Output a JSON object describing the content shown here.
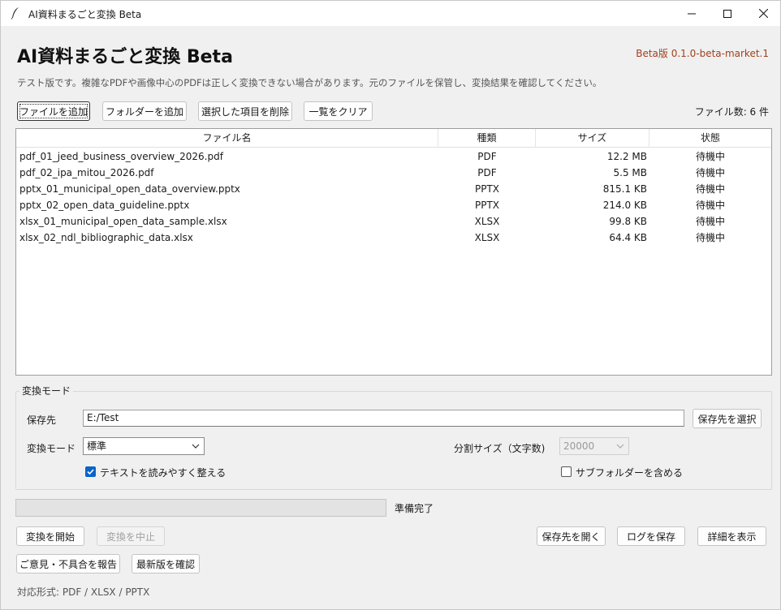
{
  "window": {
    "title": "AI資料まるごと変換 Beta"
  },
  "header": {
    "app_title": "AI資料まるごと変換 Beta",
    "version": "Beta版  0.1.0-beta-market.1",
    "notice": "テスト版です。複雑なPDFや画像中心のPDFは正しく変換できない場合があります。元のファイルを保管し、変換結果を確認してください。"
  },
  "toolbar": {
    "add_files": "ファイルを追加",
    "add_folder": "フォルダーを追加",
    "remove_selected": "選択した項目を削除",
    "clear_list": "一覧をクリア",
    "file_count": "ファイル数: 6 件"
  },
  "table": {
    "columns": [
      "ファイル名",
      "種類",
      "サイズ",
      "状態"
    ],
    "rows": [
      {
        "name": "pdf_01_jeed_business_overview_2026.pdf",
        "type": "PDF",
        "size": "12.2 MB",
        "status": "待機中"
      },
      {
        "name": "pdf_02_ipa_mitou_2026.pdf",
        "type": "PDF",
        "size": "5.5 MB",
        "status": "待機中"
      },
      {
        "name": "pptx_01_municipal_open_data_overview.pptx",
        "type": "PPTX",
        "size": "815.1 KB",
        "status": "待機中"
      },
      {
        "name": "pptx_02_open_data_guideline.pptx",
        "type": "PPTX",
        "size": "214.0 KB",
        "status": "待機中"
      },
      {
        "name": "xlsx_01_municipal_open_data_sample.xlsx",
        "type": "XLSX",
        "size": "99.8 KB",
        "status": "待機中"
      },
      {
        "name": "xlsx_02_ndl_bibliographic_data.xlsx",
        "type": "XLSX",
        "size": "64.4 KB",
        "status": "待機中"
      }
    ]
  },
  "settings": {
    "group_title": "変換モード",
    "save_to_label": "保存先",
    "save_to_value": "E:/Test",
    "choose_dest_button": "保存先を選択",
    "mode_label": "変換モード",
    "mode_value": "標準",
    "split_size_label": "分割サイズ（文字数)",
    "split_size_value": "20000",
    "tidy_text_label": "テキストを読みやすく整える",
    "tidy_text_checked": true,
    "include_subfolders_label": "サブフォルダーを含める",
    "include_subfolders_checked": false
  },
  "progress": {
    "value": 0,
    "status": "準備完了"
  },
  "actions": {
    "start": "変換を開始",
    "stop": "変換を中止",
    "open_dest": "保存先を開く",
    "save_log": "ログを保存",
    "show_details": "詳細を表示",
    "feedback": "ご意見・不具合を報告",
    "check_update": "最新版を確認"
  },
  "footer": {
    "supported_formats": "対応形式: PDF / XLSX / PPTX"
  },
  "colors": {
    "accent": "#0a64c8",
    "version_text": "#a0401e"
  }
}
